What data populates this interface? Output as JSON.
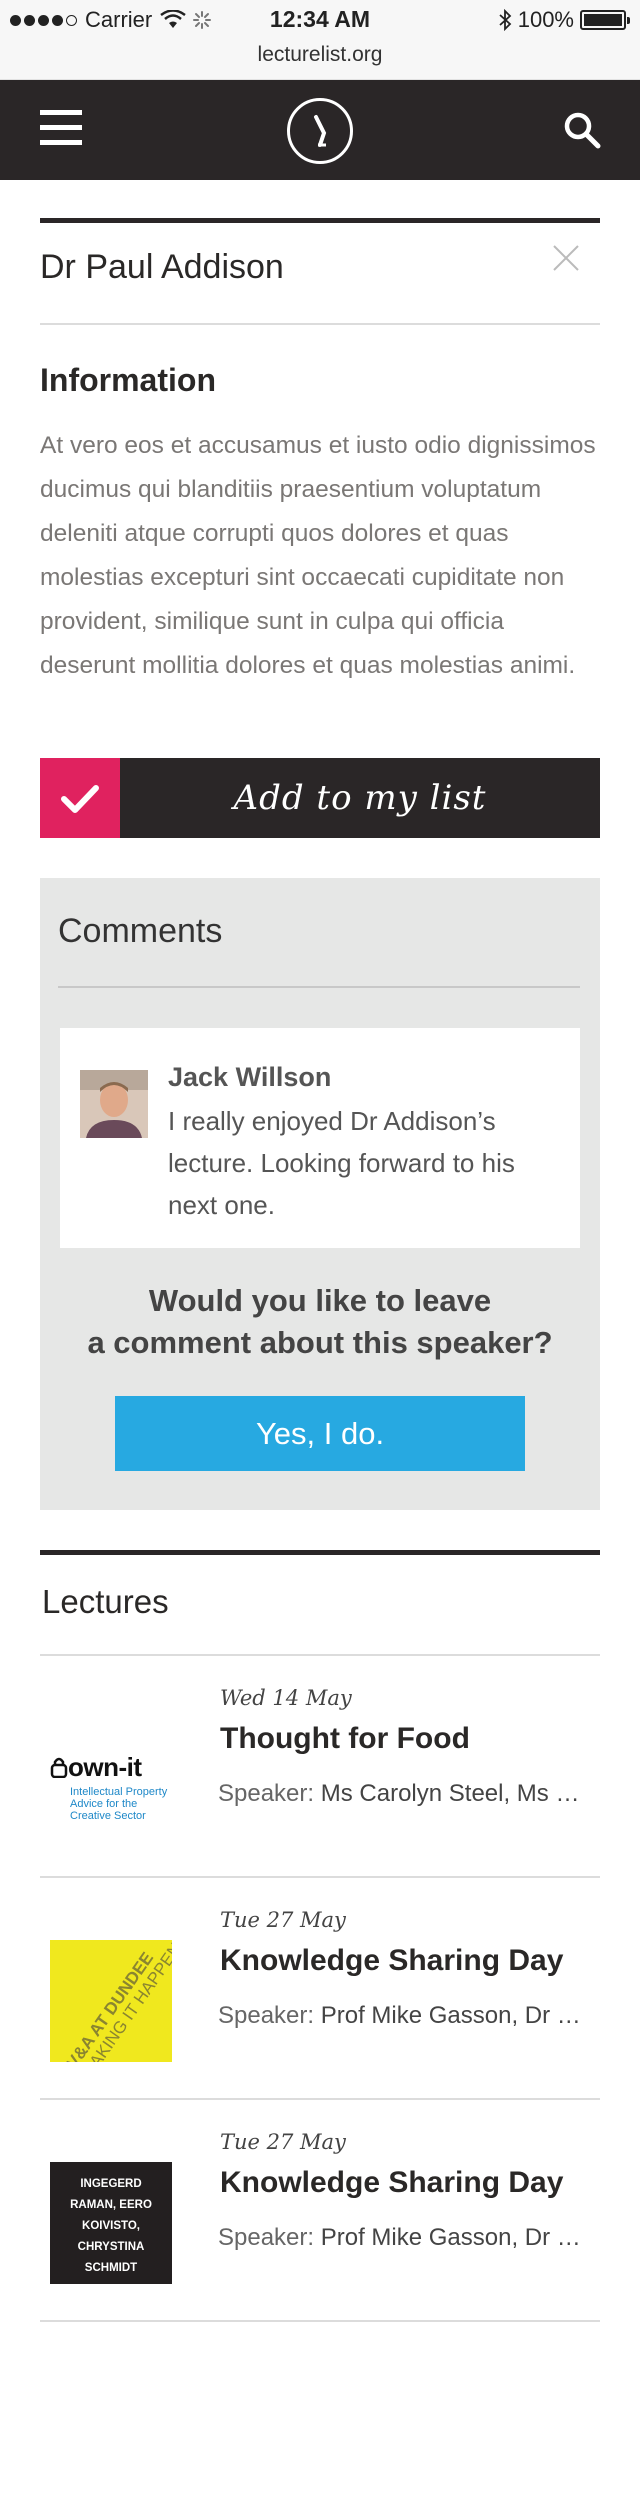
{
  "status_bar": {
    "carrier": "Carrier",
    "time": "12:34 AM",
    "battery": "100%"
  },
  "browser": {
    "url": "lecturelist.org"
  },
  "nav": {
    "menu_icon": "hamburger-icon",
    "logo_icon": "lecturelist-logo",
    "search_icon": "search-icon"
  },
  "speaker": {
    "name": "Dr Paul Addison",
    "info_title": "Information",
    "info_text": "At vero eos et accusamus et iusto odio dignissimos ducimus qui blanditiis praesentium voluptatum deleniti atque corrupti quos dolores et quas molestias excepturi sint occaecati cupiditate non provident, similique sunt in culpa qui officia deserunt mollitia dolores et quas molestias animi.",
    "add_label": "Add to my list"
  },
  "comments": {
    "title": "Comments",
    "items": [
      {
        "author": "Jack Willson",
        "text": "I really enjoyed Dr Addison’s lecture.  Looking forward to his next one."
      }
    ],
    "question_line1": "Would you like to leave",
    "question_line2": "a comment about this speaker?",
    "cta_label": "Yes, I do."
  },
  "lectures": {
    "title": "Lectures",
    "speaker_label": "Speaker:",
    "items": [
      {
        "date": "Wed 14 May",
        "title": "Thought for Food",
        "speakers": "Ms Carolyn Steel, Ms …",
        "thumb_brand": "own-it",
        "thumb_sub": "Intellectual Property Advice for the Creative Sector"
      },
      {
        "date": "Tue 27 May",
        "title": "Knowledge Sharing Day",
        "speakers": "Prof Mike Gasson, Dr …",
        "thumb_brand": "V&A AT DUNDEE",
        "thumb_sub": "MAKING IT HAPPEN"
      },
      {
        "date": "Tue 27 May",
        "title": "Knowledge Sharing Day",
        "speakers": "Prof Mike Gasson, Dr …",
        "thumb_text": "INGEGERD RAMAN, EERO KOIVISTO, CHRYSTINA SCHMIDT"
      }
    ]
  },
  "colors": {
    "nav_bg": "#2a2627",
    "accent_pink": "#e0225f",
    "cta_blue": "#27a9e1",
    "comments_bg": "#e6e7e6"
  }
}
